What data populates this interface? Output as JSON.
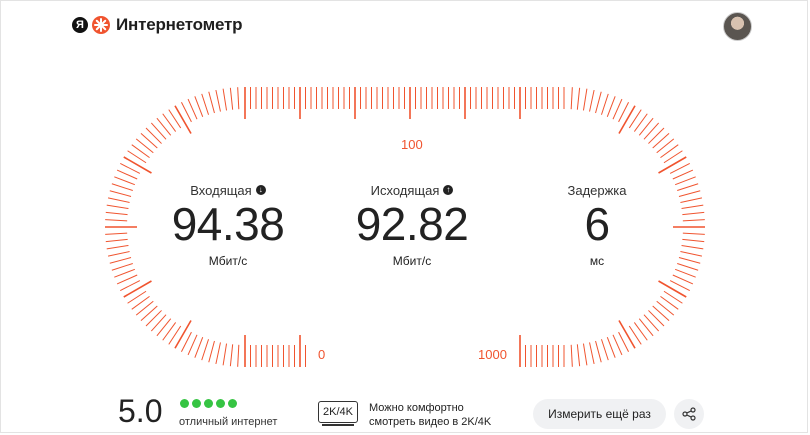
{
  "header": {
    "logo_letter": "Я",
    "title": "Интернетометр"
  },
  "metrics": {
    "download": {
      "label": "Входящая",
      "value": "94.38",
      "unit": "Мбит/с"
    },
    "upload": {
      "label": "Исходящая",
      "value": "92.82",
      "unit": "Мбит/с"
    },
    "latency": {
      "label": "Задержка",
      "value": "6",
      "unit": "мс"
    }
  },
  "scale": {
    "top_label": "100",
    "bottom_left_label": "0",
    "bottom_right_label": "1000"
  },
  "rating": {
    "score": "5.0",
    "stars_filled": 5,
    "stars_total": 5,
    "text": "отличный интернет"
  },
  "video": {
    "badge": "2K/4K",
    "line1": "Можно комфортно",
    "line2": "смотреть видео в 2K/4K"
  },
  "actions": {
    "retry_label": "Измерить ещё раз"
  },
  "colors": {
    "accent": "#f0542f",
    "stars": "#36c443",
    "button_bg": "#f0f1f3"
  },
  "icons": {
    "download": "arrow-down-circle-icon",
    "upload": "arrow-up-circle-icon",
    "share": "share-icon"
  }
}
